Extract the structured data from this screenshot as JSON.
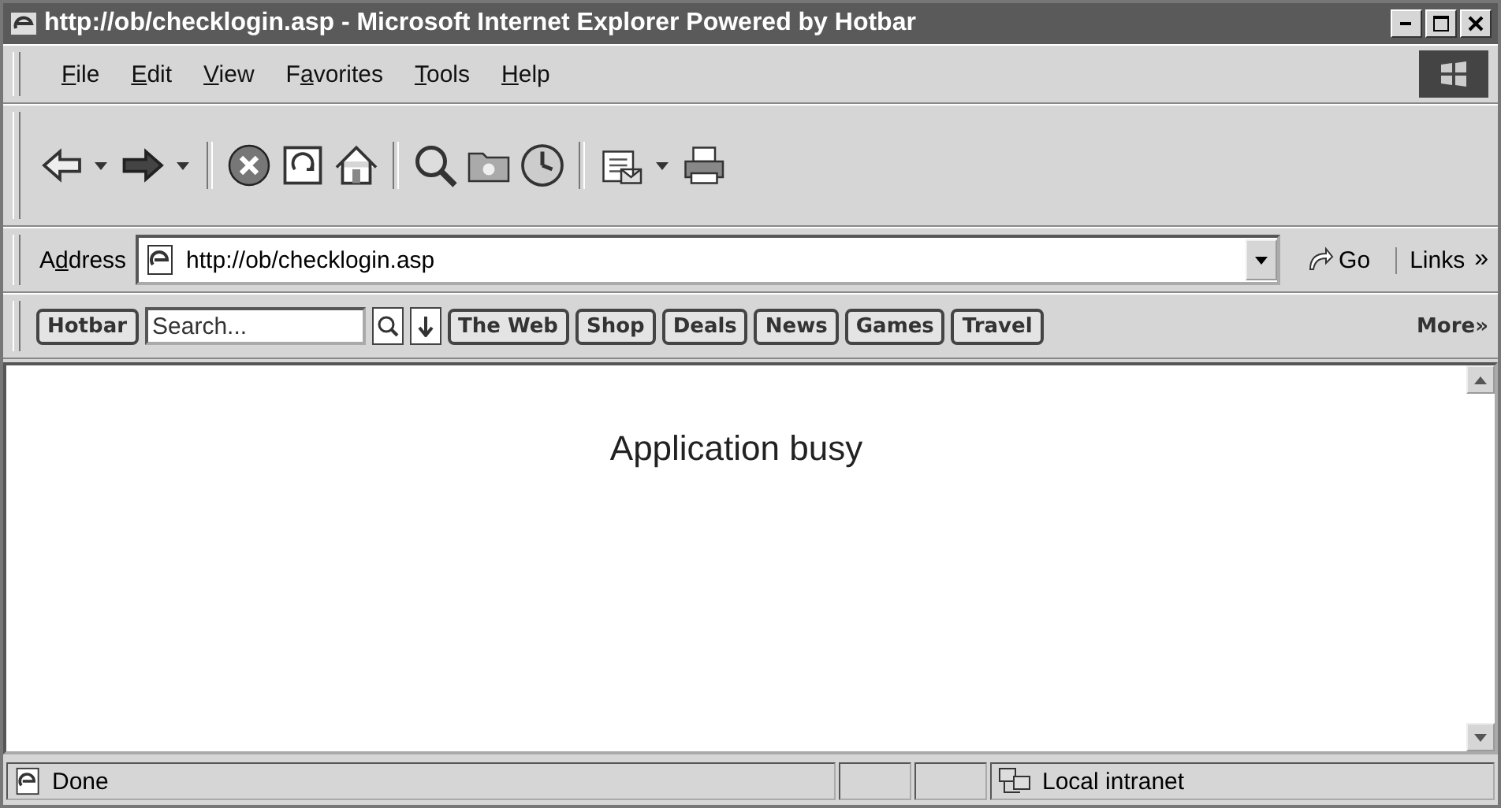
{
  "window": {
    "title": "http://ob/checklogin.asp - Microsoft Internet Explorer Powered by Hotbar"
  },
  "menu": [
    {
      "accel": "F",
      "after": "ile"
    },
    {
      "accel": "E",
      "after": "dit"
    },
    {
      "accel": "V",
      "after": "iew"
    },
    {
      "before": "F",
      "accel": "a",
      "after": "vorites"
    },
    {
      "accel": "T",
      "after": "ools"
    },
    {
      "accel": "H",
      "after": "elp"
    }
  ],
  "address_bar": {
    "before": "A",
    "accel": "d",
    "after": "dress",
    "url": "http://ob/checklogin.asp",
    "go": "Go",
    "links": "Links",
    "links_more": "»"
  },
  "hotbar": {
    "brand": "Hotbar",
    "search_placeholder": "Search...",
    "buttons": [
      "The Web",
      "Shop",
      "Deals",
      "News",
      "Games",
      "Travel"
    ],
    "more": "More»"
  },
  "page": {
    "message": "Application busy"
  },
  "status_bar": {
    "text": "Done",
    "zone": "Local intranet"
  }
}
